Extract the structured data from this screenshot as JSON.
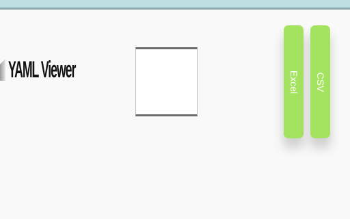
{
  "app": {
    "title": "YAML Viewer",
    "icon": "document-icon"
  },
  "input": {
    "value": "",
    "placeholder": ""
  },
  "export": {
    "excel_label": "Excel",
    "csv_label": "CSV",
    "button_color": "#a4e35f"
  },
  "colors": {
    "top_bar": "#bfe0e3",
    "top_bar_border": "#8aa6ab",
    "background": "#f9f9f9"
  }
}
